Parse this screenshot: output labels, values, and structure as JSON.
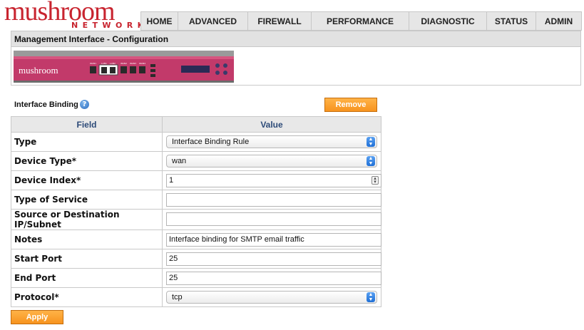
{
  "brand": {
    "name": "mushroom",
    "sub": "NETWORKS"
  },
  "nav": [
    "HOME",
    "ADVANCED",
    "FIREWALL",
    "PERFORMANCE",
    "DIAGNOSTIC",
    "STATUS",
    "ADMIN"
  ],
  "panel": {
    "title": "Management Interface - Configuration"
  },
  "device": {
    "brand": "mushroom",
    "port_labels": [
      "WAN1",
      "LAN1",
      "LAN2",
      "WAN2",
      "WAN3",
      "WAN4"
    ]
  },
  "section": {
    "title": "Interface Binding",
    "help_glyph": "?"
  },
  "buttons": {
    "remove": "Remove",
    "apply": "Apply"
  },
  "table": {
    "headers": {
      "field": "Field",
      "value": "Value"
    },
    "rows": [
      {
        "label": "Type",
        "control": "select",
        "value": "Interface Binding Rule"
      },
      {
        "label": "Device Type*",
        "control": "select",
        "value": "wan"
      },
      {
        "label": "Device Index*",
        "control": "number",
        "value": "1"
      },
      {
        "label": "Type of Service",
        "control": "text",
        "value": ""
      },
      {
        "label": "Source or Destination IP/Subnet",
        "control": "text",
        "value": ""
      },
      {
        "label": "Notes",
        "control": "text",
        "value": "Interface binding for SMTP email traffic"
      },
      {
        "label": "Start Port",
        "control": "text",
        "value": "25"
      },
      {
        "label": "End Port",
        "control": "text",
        "value": "25"
      },
      {
        "label": "Protocol*",
        "control": "select",
        "value": "tcp"
      }
    ]
  },
  "colors": {
    "brand_red": "#c8242f",
    "button_orange": "#f7931e",
    "header_blue": "#2c4a78"
  }
}
